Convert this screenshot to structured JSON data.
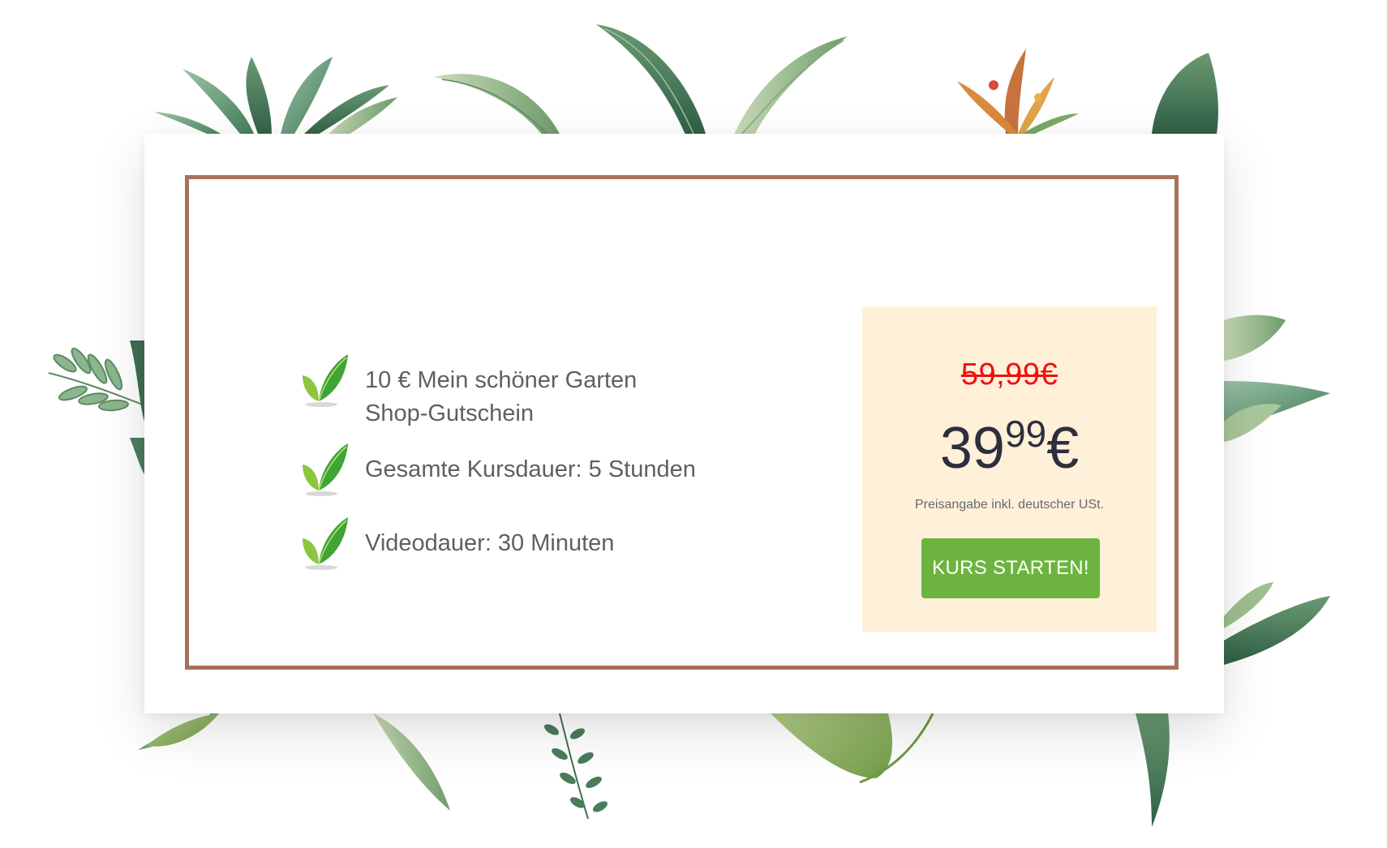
{
  "pricing": {
    "features": [
      {
        "lines": [
          "10 € Mein schöner Garten",
          "Shop-Gutschein"
        ]
      },
      {
        "lines": [
          "Gesamte Kursdauer: 5 Stunden"
        ]
      },
      {
        "lines": [
          "Videodauer: 30 Minuten"
        ]
      }
    ],
    "old_price": "59,99€",
    "new_price_main": "39",
    "new_price_cents": "99",
    "currency": "€",
    "tax_note": "Preisangabe inkl. deutscher USt.",
    "cta_label": "KURS STARTEN!"
  },
  "icons": {
    "feature_icon": "green-leaf-check-icon",
    "background": "botanical-leaves-illustration"
  },
  "colors": {
    "frame_border": "#a9715a",
    "price_box_bg": "#fff0d9",
    "old_price": "#ee1111",
    "new_price": "#2d2f3d",
    "cta_bg": "#6cb43f",
    "feature_text": "#5f5f5f"
  }
}
